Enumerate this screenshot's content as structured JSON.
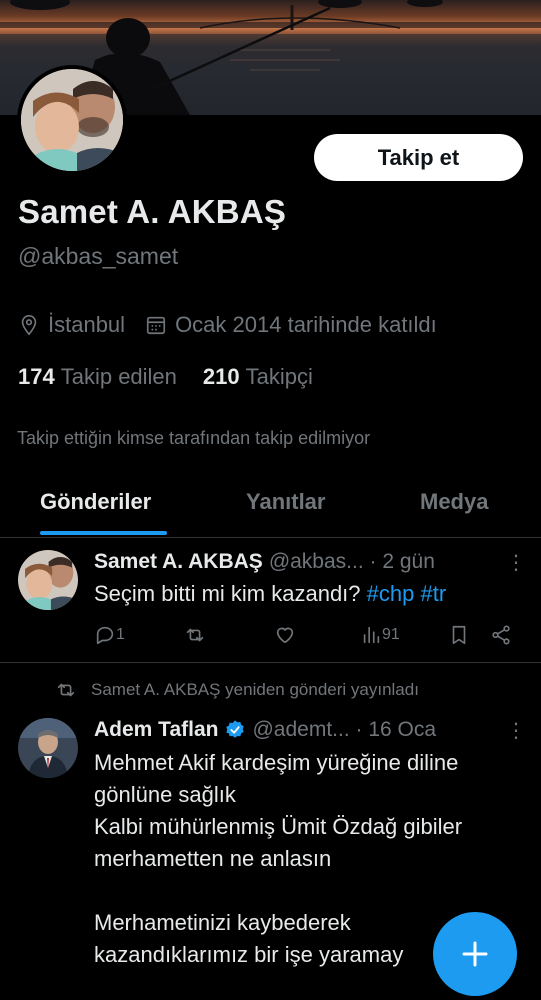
{
  "profile": {
    "follow_label": "Takip et",
    "name": "Samet A. AKBAŞ",
    "handle": "@akbas_samet",
    "location": "İstanbul",
    "joined": "Ocak 2014 tarihinde katıldı",
    "following_count": "174",
    "following_label": "Takip edilen",
    "followers_count": "210",
    "followers_label": "Takipçi",
    "mutual_text": "Takip ettiğin kimse tarafından takip edilmiyor"
  },
  "tabs": [
    {
      "label": "Gönderiler",
      "active": true
    },
    {
      "label": "Yanıtlar",
      "active": false
    },
    {
      "label": "Medya",
      "active": false
    }
  ],
  "posts": [
    {
      "author": "Samet A. AKBAŞ",
      "handle_time": "@akbas... · 2 gün",
      "text_plain": "Seçim bitti mi kim kazandı?",
      "hashtags": [
        "#chp",
        "#tr"
      ],
      "replies": "1",
      "views": "91",
      "more_icon": "more-vertical-icon"
    },
    {
      "repost_note": "Samet A. AKBAŞ yeniden gönderi yayınladı",
      "author": "Adem Taflan",
      "handle_time": "@ademt... · 16 Oca",
      "lines": [
        "Mehmet Akif kardeşim yüreğine diline",
        "gönlüne sağlık",
        "Kalbi mühürlenmiş Ümit Özdağ gibiler",
        "merhametten ne anlasın",
        "",
        "Merhametinizi kaybederek",
        "kazandıklarımız bir işe yaramay"
      ]
    }
  ],
  "colors": {
    "accent": "#1d9bf0",
    "muted": "#71767b",
    "text": "#e7e9ea",
    "background": "#000000"
  },
  "icons": {
    "location": "location-pin-icon",
    "calendar": "calendar-icon",
    "reply": "reply-icon",
    "repost": "repost-icon",
    "like": "heart-icon",
    "views": "views-chart-icon",
    "bookmark": "bookmark-icon",
    "share": "share-icon",
    "verified": "verified-badge-icon",
    "compose": "plus-icon"
  }
}
